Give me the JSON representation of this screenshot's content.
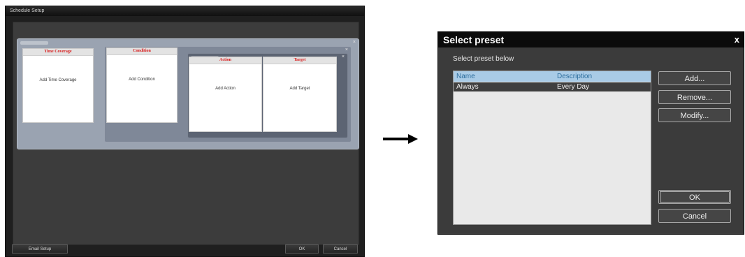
{
  "schedule_window": {
    "title": "Schedule Setup",
    "cards": {
      "time_coverage": {
        "header": "Time Coverage",
        "body": "Add Time Coverage"
      },
      "condition": {
        "header": "Condition",
        "body": "Add Condition"
      },
      "action": {
        "header": "Action",
        "body": "Add Action"
      },
      "target": {
        "header": "Target",
        "body": "Add Target"
      }
    },
    "buttons": {
      "email_setup": "Email Setup",
      "ok": "OK",
      "cancel": "Cancel"
    }
  },
  "arrow": {
    "icon": "right-arrow-icon"
  },
  "select_preset_dialog": {
    "title": "Select preset",
    "close_glyph": "x",
    "hint": "Select preset below",
    "list": {
      "columns": [
        "Name",
        "Description"
      ],
      "rows": [
        {
          "name": "Always",
          "description": "Every Day"
        }
      ]
    },
    "buttons": {
      "add": "Add...",
      "remove": "Remove...",
      "modify": "Modify...",
      "ok": "OK",
      "cancel": "Cancel"
    }
  }
}
